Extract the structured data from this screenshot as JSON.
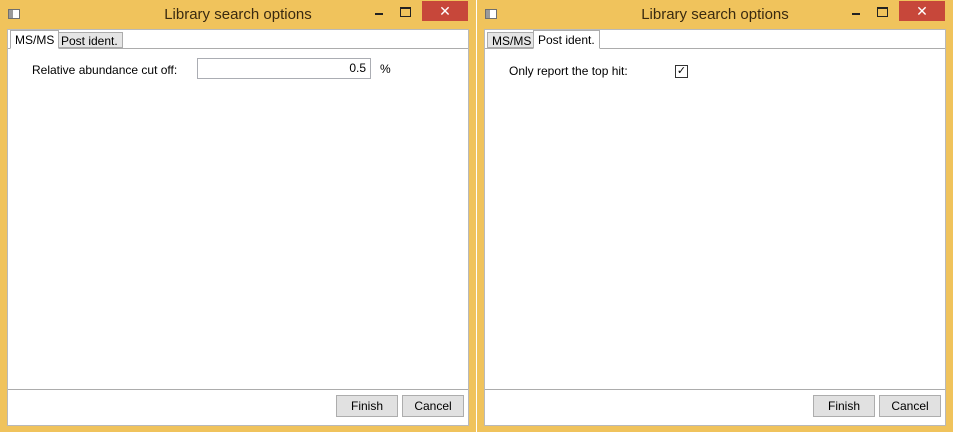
{
  "windows": [
    {
      "title": "Library search options",
      "title_buttons": {
        "minimize": "–",
        "maximize": "□",
        "close": "✕"
      },
      "tabs": [
        {
          "label": "MS/MS",
          "selected": true
        },
        {
          "label": "Post ident.",
          "selected": false
        }
      ],
      "panel": {
        "relative_abundance_label": "Relative abundance cut off:",
        "relative_abundance_value": "0.5",
        "unit": "%"
      },
      "footer": {
        "finish_label": "Finish",
        "cancel_label": "Cancel"
      }
    },
    {
      "title": "Library search options",
      "title_buttons": {
        "minimize": "–",
        "maximize": "□",
        "close": "✕"
      },
      "tabs": [
        {
          "label": "MS/MS",
          "selected": false
        },
        {
          "label": "Post ident.",
          "selected": true
        }
      ],
      "panel": {
        "top_hit_label": "Only report the top hit:",
        "top_hit_checked": true,
        "check_glyph": "✓"
      },
      "footer": {
        "finish_label": "Finish",
        "cancel_label": "Cancel"
      }
    }
  ],
  "colors": {
    "window_frame": "#f0c35c",
    "close_button": "#c7473a",
    "button_face": "#e1e1e1",
    "tab_unselected": "#e5e5e5"
  }
}
